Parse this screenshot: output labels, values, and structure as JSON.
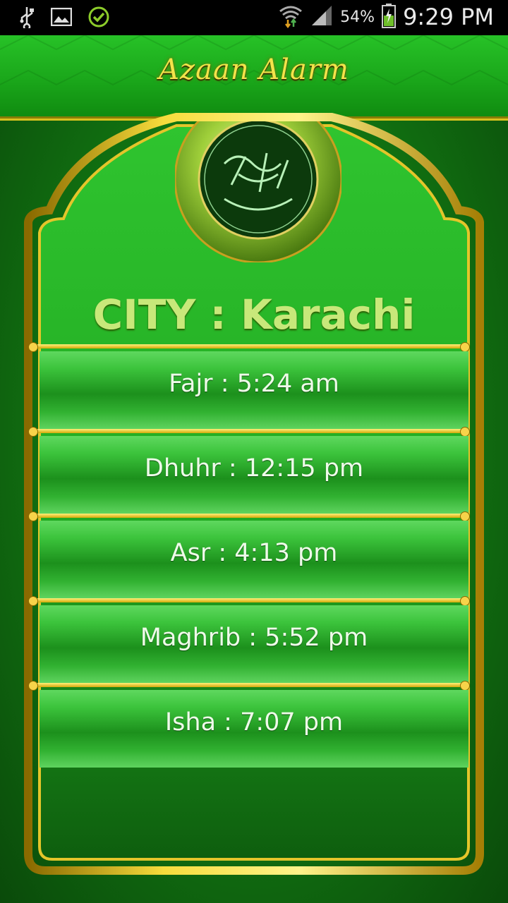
{
  "status_bar": {
    "battery_percent": "54%",
    "time": "9:29 PM",
    "icons": [
      "usb-icon",
      "image-icon",
      "check-icon",
      "wifi-icon",
      "signal-icon",
      "battery-icon"
    ]
  },
  "header": {
    "title": "Azaan Alarm"
  },
  "city_label": "CITY : Karachi",
  "prayers": [
    {
      "label": "Fajr : 5:24 am"
    },
    {
      "label": "Dhuhr : 12:15 pm"
    },
    {
      "label": "Asr : 4:13 pm"
    },
    {
      "label": "Maghrib : 5:52 pm"
    },
    {
      "label": "Isha : 7:07 pm"
    }
  ],
  "colors": {
    "accent_gold": "#f3e34a",
    "primary_green": "#1aa61a",
    "city_text": "#c8e87a"
  }
}
